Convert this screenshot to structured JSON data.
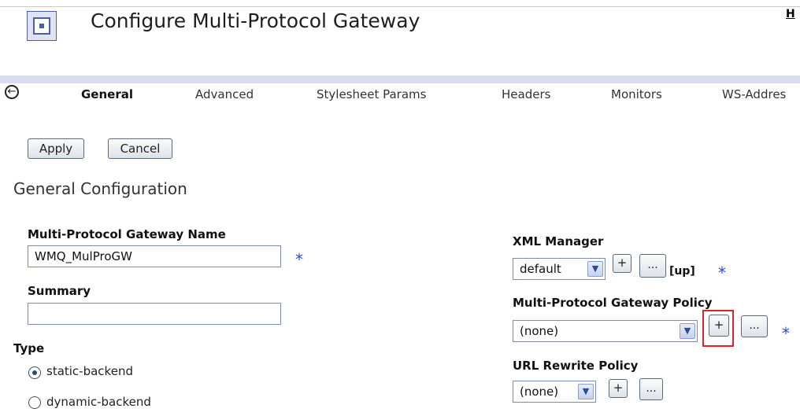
{
  "header": {
    "title": "Configure Multi-Protocol Gateway",
    "help_link": "H",
    "icon": "gateway-app-icon"
  },
  "tabs": [
    {
      "label": "General",
      "active": true
    },
    {
      "label": "Advanced",
      "active": false
    },
    {
      "label": "Stylesheet Params",
      "active": false
    },
    {
      "label": "Headers",
      "active": false
    },
    {
      "label": "Monitors",
      "active": false
    },
    {
      "label": "WS-Addres",
      "active": false
    }
  ],
  "toolbar": {
    "apply_label": "Apply",
    "cancel_label": "Cancel"
  },
  "section": {
    "heading": "General Configuration"
  },
  "form": {
    "name_label": "Multi-Protocol Gateway Name",
    "name_value": "WMQ_MulProGW",
    "summary_label": "Summary",
    "summary_value": "",
    "type_label": "Type",
    "type_options": [
      "static-backend",
      "dynamic-backend"
    ],
    "type_selected": "static-backend",
    "required_marker": "*"
  },
  "right_panel": {
    "xml_manager_label": "XML Manager",
    "xml_manager_value": "default",
    "xml_manager_status": "[up]",
    "policy_label": "Multi-Protocol Gateway Policy",
    "policy_value": "(none)",
    "url_rewrite_label": "URL Rewrite Policy",
    "url_rewrite_value": "(none)",
    "add_label": "+",
    "edit_label": "..."
  },
  "colors": {
    "tab_band": "#d9dcef",
    "required_marker": "#2b4bd6",
    "highlight": "#d8262b"
  }
}
